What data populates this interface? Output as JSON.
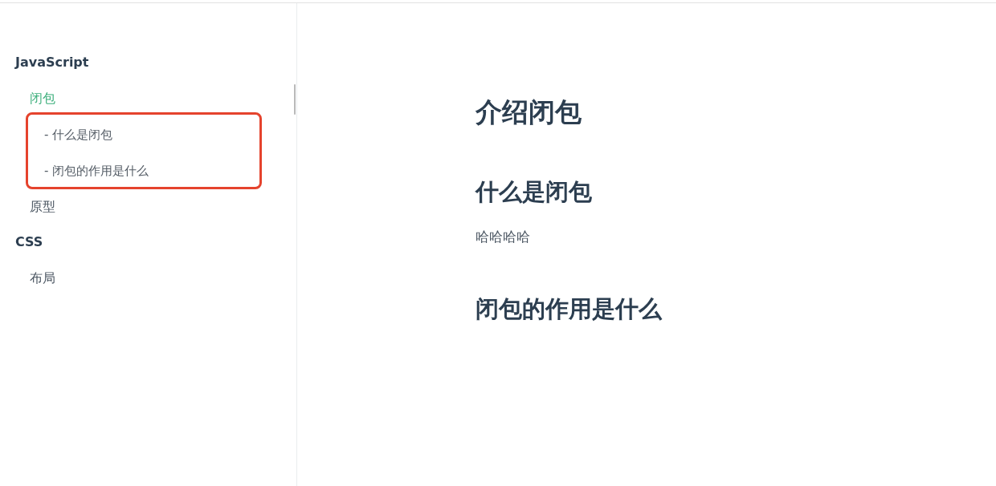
{
  "sidebar": {
    "groups": [
      {
        "title": "JavaScript",
        "items": [
          {
            "label": "闭包",
            "selected": true,
            "children_framed": true,
            "children": [
              {
                "label": "- 什么是闭包",
                "selected": false
              },
              {
                "label": "- 闭包的作用是什么",
                "selected": false
              }
            ]
          },
          {
            "label": "原型",
            "selected": false
          }
        ]
      },
      {
        "title": "CSS",
        "items": [
          {
            "label": "布局",
            "selected": false
          }
        ]
      }
    ]
  },
  "content": {
    "title": "介绍闭包",
    "sections": [
      {
        "heading": "什么是闭包",
        "paragraph": "哈哈哈哈"
      },
      {
        "heading": "闭包的作用是什么"
      }
    ]
  }
}
